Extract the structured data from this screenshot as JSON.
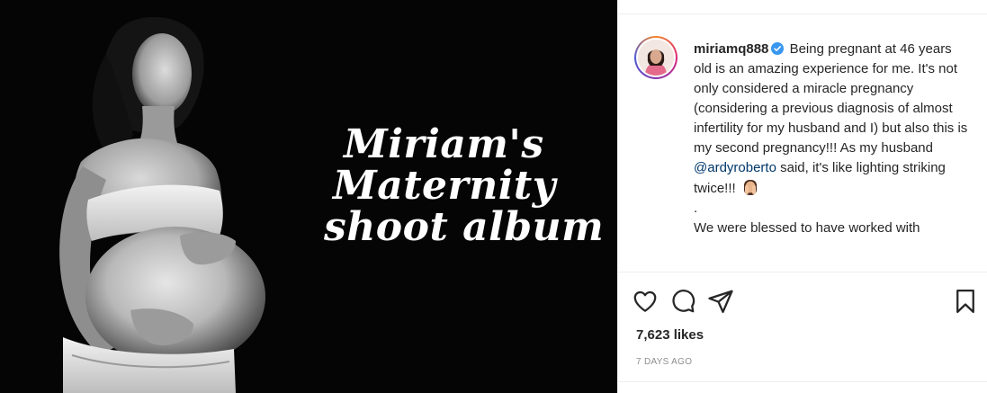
{
  "media": {
    "album_title": [
      "Miriam's",
      "Maternity",
      "shoot album"
    ]
  },
  "post": {
    "username": "miriamq888",
    "verified": true,
    "caption_lines": [
      "Being pregnant at 46 years old is an amazing experience for me. It's not only considered a miracle pregnancy (considering a previous diagnosis of almost infertility for my husband and I) but also this is my second pregnancy!!! As my husband ",
      " said, it's like lighting striking twice!!! "
    ],
    "mention": "@ardyroberto",
    "dot_line": ".",
    "continuation": "We were blessed to have worked with",
    "likes": "7,623 likes",
    "time": "7 DAYS AGO"
  },
  "icons": {
    "like": "heart-icon",
    "comment": "comment-icon",
    "share": "paper-plane-icon",
    "save": "bookmark-icon",
    "verified": "verified-badge-icon",
    "emoji": "hands-over-face-emoji"
  },
  "colors": {
    "media_background": "#050505",
    "text": "#262626",
    "mention": "#00376b",
    "muted": "#8e8e8e",
    "verified_blue": "#3897f0"
  }
}
